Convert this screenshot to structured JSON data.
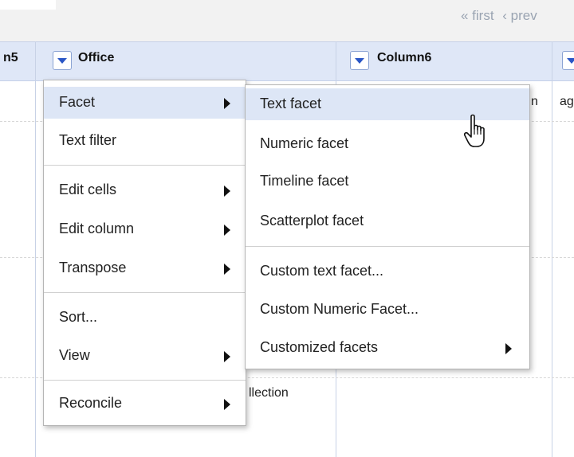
{
  "pager": {
    "first": "« first",
    "prev": "‹ prev"
  },
  "columns": [
    {
      "name": "n5"
    },
    {
      "name": "Office"
    },
    {
      "name": "Column6"
    }
  ],
  "cells": {
    "col6_r1": "n",
    "col7_r1": "ag",
    "office_r3": "llection"
  },
  "main_menu": {
    "items": [
      {
        "label": "Facet",
        "submenu": true
      },
      {
        "label": "Text filter",
        "submenu": false
      },
      {
        "label": "Edit cells",
        "submenu": true
      },
      {
        "label": "Edit column",
        "submenu": true
      },
      {
        "label": "Transpose",
        "submenu": true
      },
      {
        "label": "Sort...",
        "submenu": false
      },
      {
        "label": "View",
        "submenu": true
      },
      {
        "label": "Reconcile",
        "submenu": true
      }
    ]
  },
  "facet_menu": {
    "items": [
      {
        "label": "Text facet"
      },
      {
        "label": "Numeric facet"
      },
      {
        "label": "Timeline facet"
      },
      {
        "label": "Scatterplot facet"
      },
      {
        "label": "Custom text facet..."
      },
      {
        "label": "Custom Numeric Facet..."
      },
      {
        "label": "Customized facets",
        "submenu": true
      }
    ]
  },
  "colors": {
    "accent": "#2a56c6",
    "highlight": "#dde6f6",
    "header_bg": "#dfe7f7"
  },
  "icons": {
    "cursor": "hand-pointer-icon",
    "dropdown": "dropdown-triangle-icon",
    "submenu": "submenu-arrow-icon"
  }
}
